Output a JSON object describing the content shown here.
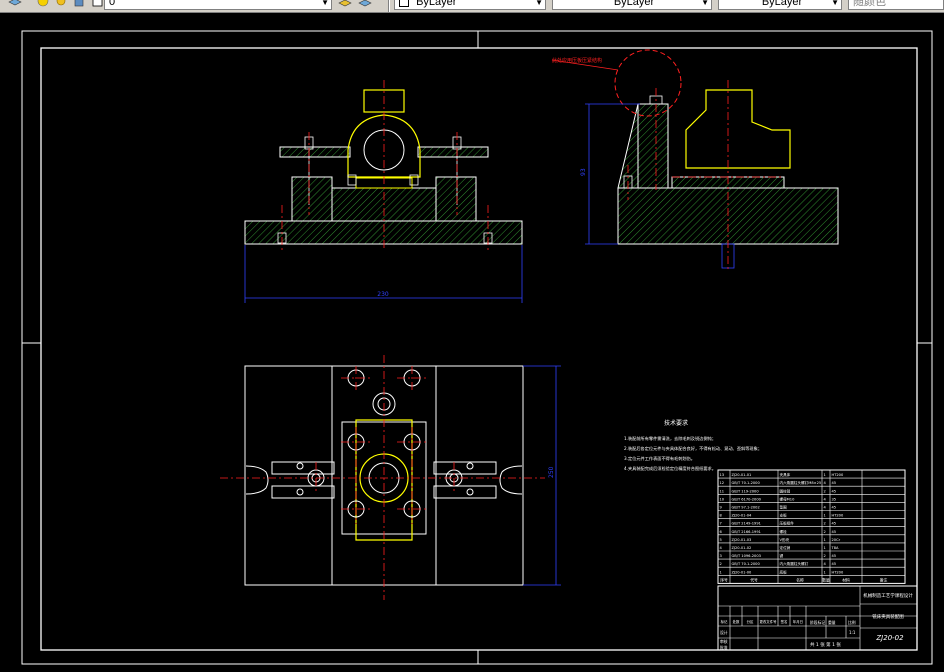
{
  "toolbar": {
    "layer_value": "0",
    "color_value": "ByLayer",
    "linetype_value": "ByLayer",
    "lineweight_value": "ByLayer",
    "plotstyle_value": "随颜色"
  },
  "drawing": {
    "dimension_front": "230",
    "dimension_side": "93",
    "dimension_top": "250",
    "callout_note": "此处应用压板压紧结构",
    "tech_title": "技术要求",
    "tech_requirements": [
      "1.装配前所有零件需清洗，去除毛刺及锐边倒钝；",
      "2.装配后各定位元件与夹具体配合良好，不得有松动、晃动、歪斜等现象；",
      "3.定位元件工作表面不得有毛刺划伤。",
      "4.夹具装配完成后须检验定位精度符合图纸要求。"
    ],
    "bom_headers": [
      "序号",
      "代号",
      "名称",
      "数量",
      "材料",
      "备注"
    ],
    "bom_rows": [
      [
        "13",
        "ZJ20-01-01",
        "夹具体",
        "1",
        "HT200",
        ""
      ],
      [
        "12",
        "GB/T 70.1-2000",
        "内六角圆柱头螺钉M8×25",
        "4",
        "45",
        ""
      ],
      [
        "11",
        "GB/T 119-2000",
        "圆柱销",
        "2",
        "45",
        ""
      ],
      [
        "10",
        "GB/T 6170-2000",
        "螺母M10",
        "4",
        "35",
        ""
      ],
      [
        "9",
        "GB/T 97.1-2002",
        "垫圈",
        "4",
        "45",
        ""
      ],
      [
        "8",
        "ZJ20-01-04",
        "支板",
        "1",
        "HT200",
        ""
      ],
      [
        "7",
        "GB/T 2149-1991",
        "压板组件",
        "2",
        "45",
        ""
      ],
      [
        "6",
        "GB/T 2166-1991",
        "螺栓",
        "2",
        "45",
        ""
      ],
      [
        "5",
        "ZJ20-01-03",
        "V形块",
        "1",
        "20Cr",
        ""
      ],
      [
        "4",
        "ZJ20-01-02",
        "定位销",
        "1",
        "T8A",
        ""
      ],
      [
        "3",
        "GB/T 1096-2003",
        "键",
        "2",
        "45",
        ""
      ],
      [
        "2",
        "GB/T 70.1-2000",
        "内六角圆柱头螺钉",
        "4",
        "45",
        ""
      ],
      [
        "1",
        "ZJ20-01-00",
        "底板",
        "1",
        "HT200",
        ""
      ]
    ],
    "title_block": {
      "school": "机械制造工艺学课程设计",
      "drawing_name": "铣床夹具装配图",
      "drawing_number": "ZJ20-02",
      "scale_label": "比例",
      "scale_value": "1:1",
      "sheet_label": "共 1 张 第 1 张",
      "designer_label": "设计",
      "checker_label": "审核",
      "approver_label": "批准",
      "stage_label": "阶段标记",
      "weight_label": "重量",
      "revision_headers": [
        "标记",
        "处数",
        "分区",
        "更改文件号",
        "签名",
        "年月日"
      ]
    }
  }
}
